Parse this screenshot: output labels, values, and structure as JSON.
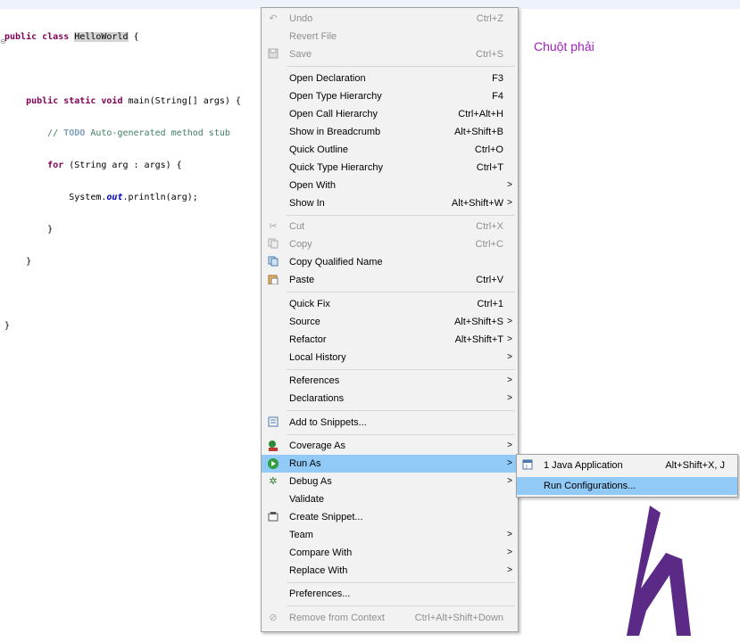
{
  "code": {
    "lines": [
      {
        "class_kw": "public class ",
        "class_name": "HelloWorld",
        "brace": " {"
      },
      {
        "text": ""
      },
      {
        "indent": "    ",
        "kw": "public static void ",
        "rest": "main(String[] args) {"
      },
      {
        "indent": "        ",
        "cmt_pre": "// ",
        "todo": "TODO",
        "cmt_post": " Auto-generated method stub"
      },
      {
        "indent": "        ",
        "kw": "for ",
        "rest": "(String arg : args) {"
      },
      {
        "indent": "            ",
        "pre": "System.",
        "field": "out",
        "post": ".println(arg);"
      },
      {
        "indent": "        ",
        "rest": "}"
      },
      {
        "indent": "    ",
        "rest": "}"
      },
      {
        "text": ""
      },
      {
        "rest": "}"
      }
    ]
  },
  "annotation": "Chuột phải",
  "context_menu": {
    "items": [
      {
        "label": "Undo",
        "shortcut": "Ctrl+Z",
        "icon": "undo-icon",
        "disabled": true
      },
      {
        "label": "Revert File",
        "shortcut": "",
        "disabled": true
      },
      {
        "label": "Save",
        "shortcut": "Ctrl+S",
        "icon": "save-icon",
        "disabled": true
      },
      {
        "label": "Open Declaration",
        "shortcut": "F3"
      },
      {
        "label": "Open Type Hierarchy",
        "shortcut": "F4"
      },
      {
        "label": "Open Call Hierarchy",
        "shortcut": "Ctrl+Alt+H"
      },
      {
        "label": "Show in Breadcrumb",
        "shortcut": "Alt+Shift+B"
      },
      {
        "label": "Quick Outline",
        "shortcut": "Ctrl+O"
      },
      {
        "label": "Quick Type Hierarchy",
        "shortcut": "Ctrl+T"
      },
      {
        "label": "Open With",
        "arrow": ">"
      },
      {
        "label": "Show In",
        "shortcut": "Alt+Shift+W",
        "arrow": ">"
      },
      {
        "label": "Cut",
        "shortcut": "Ctrl+X",
        "icon": "cut-icon",
        "disabled": true
      },
      {
        "label": "Copy",
        "shortcut": "Ctrl+C",
        "icon": "copy-icon",
        "disabled": true
      },
      {
        "label": "Copy Qualified Name",
        "icon": "copy-qualified-name-icon"
      },
      {
        "label": "Paste",
        "shortcut": "Ctrl+V",
        "icon": "paste-icon"
      },
      {
        "label": "Quick Fix",
        "shortcut": "Ctrl+1"
      },
      {
        "label": "Source",
        "shortcut": "Alt+Shift+S",
        "arrow": ">"
      },
      {
        "label": "Refactor",
        "shortcut": "Alt+Shift+T",
        "arrow": ">"
      },
      {
        "label": "Local History",
        "arrow": ">"
      },
      {
        "label": "References",
        "arrow": ">"
      },
      {
        "label": "Declarations",
        "arrow": ">"
      },
      {
        "label": "Add to Snippets...",
        "icon": "snippet-icon"
      },
      {
        "label": "Coverage As",
        "arrow": ">",
        "icon": "coverage-icon"
      },
      {
        "label": "Run As",
        "arrow": ">",
        "icon": "run-icon",
        "highlighted": true
      },
      {
        "label": "Debug As",
        "arrow": ">",
        "icon": "debug-icon"
      },
      {
        "label": "Validate"
      },
      {
        "label": "Create Snippet...",
        "icon": "create-snippet-icon"
      },
      {
        "label": "Team",
        "arrow": ">"
      },
      {
        "label": "Compare With",
        "arrow": ">"
      },
      {
        "label": "Replace With",
        "arrow": ">"
      },
      {
        "label": "Preferences..."
      },
      {
        "label": "Remove from Context",
        "shortcut": "Ctrl+Alt+Shift+Down",
        "icon": "remove-context-icon",
        "disabled": true
      }
    ]
  },
  "submenu": {
    "items": [
      {
        "label": "1 Java Application",
        "shortcut": "Alt+Shift+X, J",
        "icon": "java-application-icon"
      },
      {
        "label": "Run Configurations...",
        "highlighted": true
      }
    ]
  },
  "colors": {
    "highlight": "#91c9f7",
    "annotation": "#a020c0",
    "logo": "#5b2a86"
  }
}
